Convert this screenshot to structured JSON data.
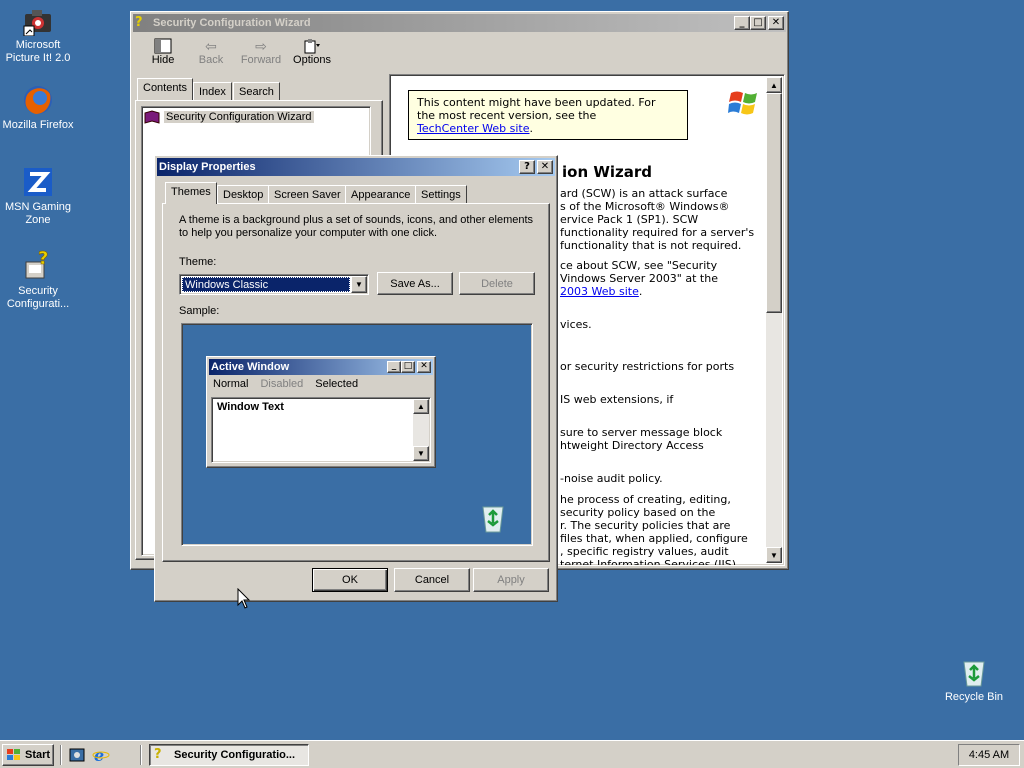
{
  "desktop": {
    "icons": [
      {
        "label": "Microsoft Picture It! 2.0",
        "icon": "camera-icon"
      },
      {
        "label": "Mozilla Firefox",
        "icon": "firefox-icon"
      },
      {
        "label": "MSN Gaming Zone",
        "icon": "zone-icon"
      },
      {
        "label": "Security Configurati...",
        "icon": "security-wizard-icon"
      },
      {
        "label": "Recycle Bin",
        "icon": "recycle-bin-icon"
      }
    ]
  },
  "help_window": {
    "title": "Security Configuration Wizard",
    "toolbar": {
      "hide": "Hide",
      "back": "Back",
      "forward": "Forward",
      "options": "Options"
    },
    "tabs": [
      "Contents",
      "Index",
      "Search"
    ],
    "tree_item": "Security Configuration Wizard",
    "notice": {
      "line1": "This content might have been updated. For",
      "line2": "the most recent version, see the",
      "link": "TechCenter Web site",
      "after": "."
    },
    "heading": "ion Wizard",
    "body_lines": [
      "ard (SCW) is an attack surface",
      "s of the Microsoft® Windows®",
      "ervice Pack 1 (SP1). SCW",
      "functionality required for a server's",
      "functionality that is not required."
    ],
    "body2_lines": [
      "ce about SCW, see \"Security",
      "Vindows Server 2003\" at the"
    ],
    "body2_link": "2003 Web site",
    "body2_after": ".",
    "fragments": [
      "vices.",
      "or security restrictions for ports",
      "IS web extensions, if",
      "sure to server message block",
      "htweight Directory Access",
      "-noise audit policy."
    ],
    "body3_lines": [
      "he process of creating, editing,",
      "security policy based on the",
      "r. The security policies that are",
      "files that, when applied, configure",
      ", specific registry values, audit",
      "ternet Information Services (IIS)"
    ]
  },
  "display_properties": {
    "title": "Display Properties",
    "help_button": "?",
    "close_button": "✕",
    "tabs": [
      "Themes",
      "Desktop",
      "Screen Saver",
      "Appearance",
      "Settings"
    ],
    "description_line1": "A theme is a background plus a set of sounds, icons, and other elements",
    "description_line2": "to help you personalize your computer with one click.",
    "theme_label": "Theme:",
    "theme_value": "Windows Classic",
    "save_as": "Save As...",
    "delete": "Delete",
    "sample_label": "Sample:",
    "sample": {
      "window_title": "Active Window",
      "menu": [
        "Normal",
        "Disabled",
        "Selected"
      ],
      "window_text": "Window Text"
    },
    "ok": "OK",
    "cancel": "Cancel",
    "apply": "Apply"
  },
  "taskbar": {
    "start": "Start",
    "task": "Security Configuratio...",
    "clock": "4:45 AM"
  },
  "colors": {
    "desktop": "#3a6ea5",
    "titlebar_active": "#0a246a",
    "face": "#d4d0c8"
  }
}
